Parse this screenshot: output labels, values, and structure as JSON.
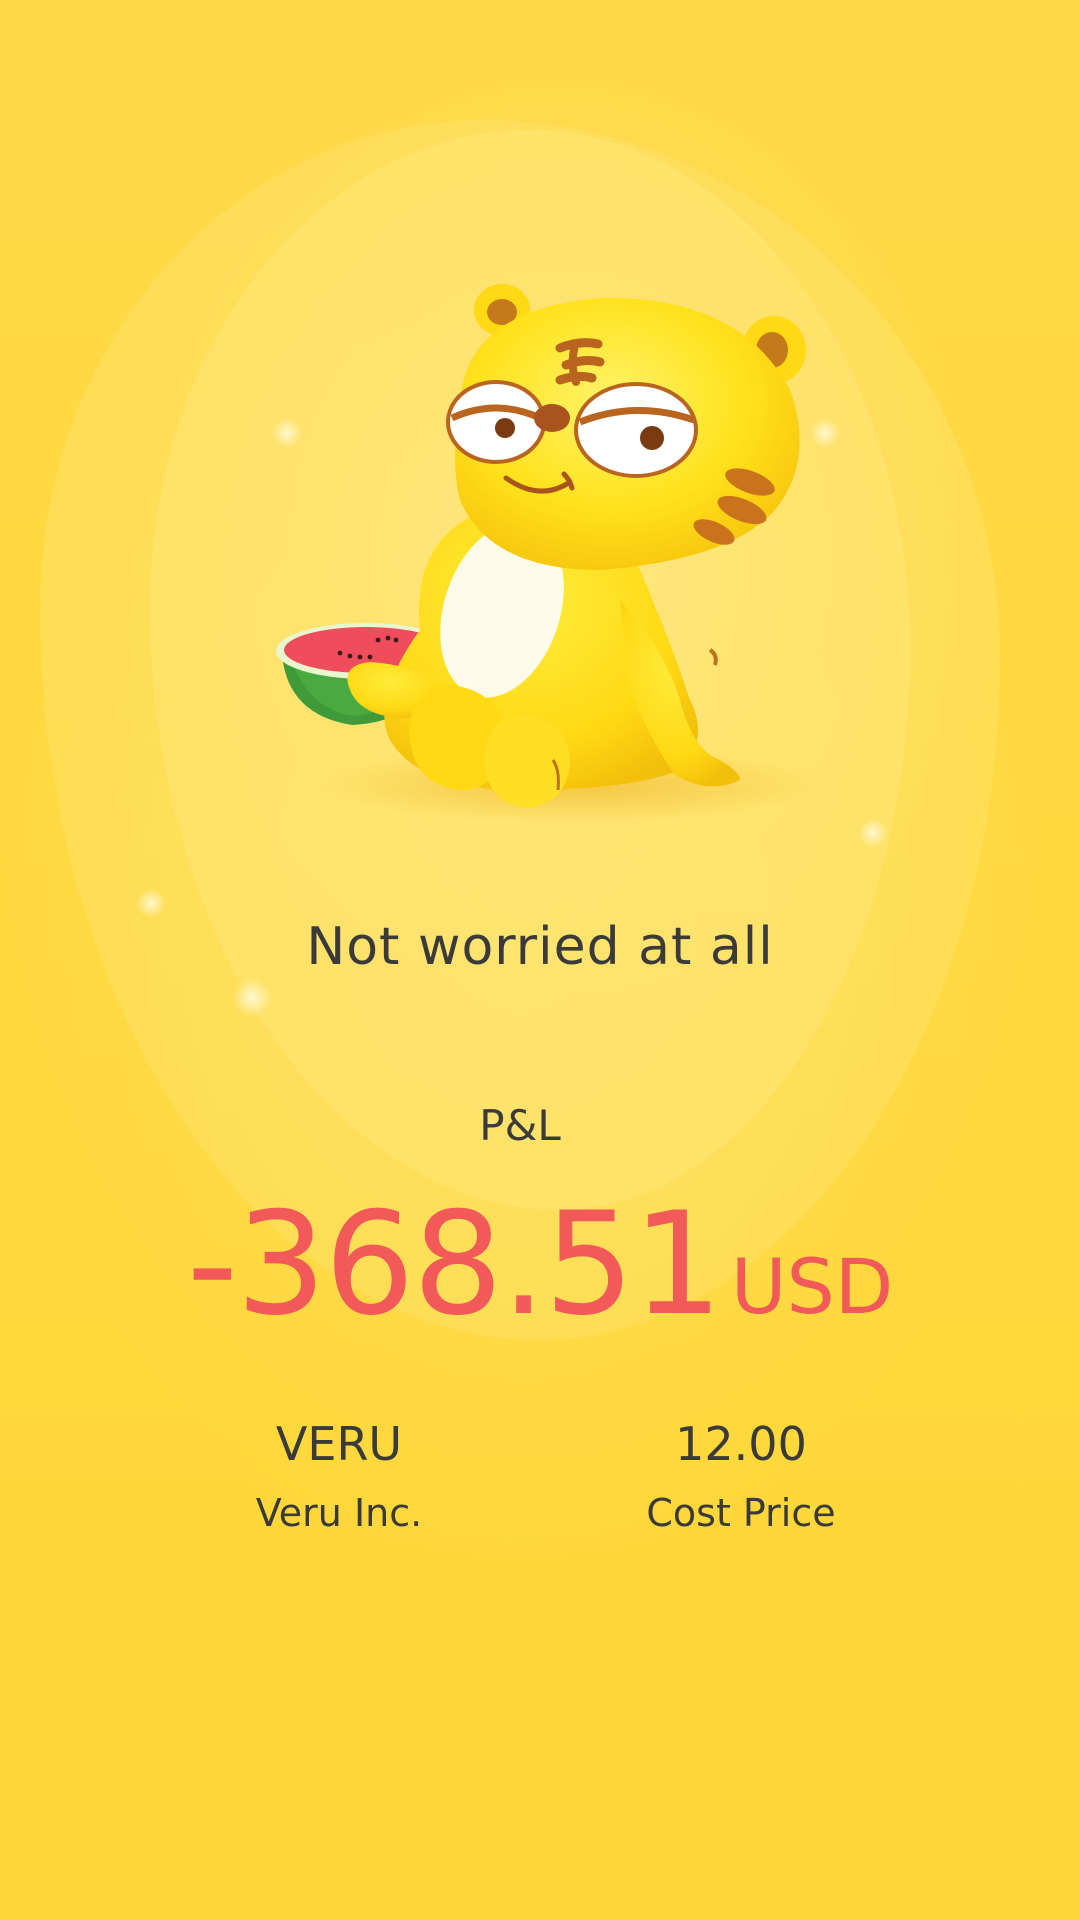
{
  "mascot": {
    "description_icon": "tiger-mascot-icon",
    "prop_icon": "watermelon-icon"
  },
  "status": {
    "message": "Not worried at all"
  },
  "pnl": {
    "label": "P&L",
    "value": "-368.51",
    "currency": "USD",
    "color": "#f25a5a"
  },
  "stock": {
    "ticker": "VERU",
    "name": "Veru Inc."
  },
  "cost": {
    "value": "12.00",
    "label": "Cost Price"
  },
  "colors": {
    "background": "#ffd93f",
    "text": "#3a3a3a",
    "loss": "#f25a5a"
  }
}
